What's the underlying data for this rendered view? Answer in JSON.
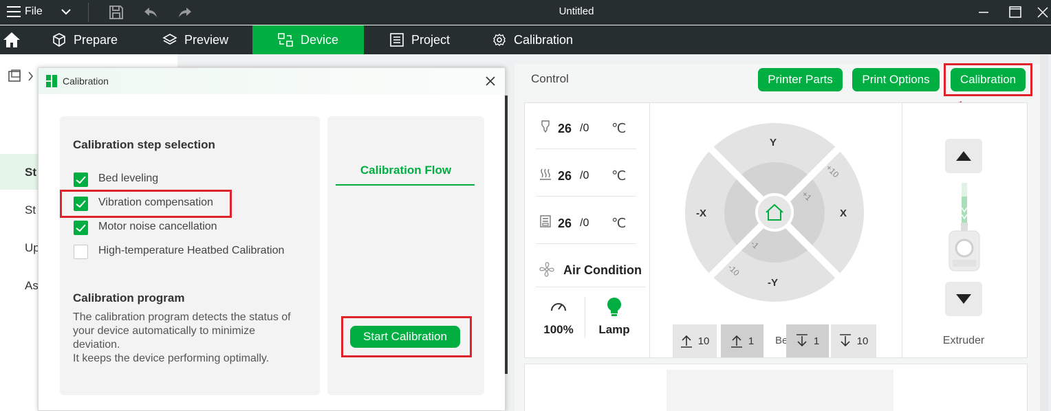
{
  "titlebar": {
    "file_label": "File",
    "doc_title": "Untitled"
  },
  "nav": {
    "tabs": [
      {
        "label": "Prepare",
        "icon": "cube-icon"
      },
      {
        "label": "Preview",
        "icon": "layers-icon"
      },
      {
        "label": "Device",
        "icon": "device-icon",
        "active": true
      },
      {
        "label": "Project",
        "icon": "project-icon"
      },
      {
        "label": "Calibration",
        "icon": "gear-icon"
      }
    ]
  },
  "sidebar": {
    "items": [
      "St",
      "St",
      "Up",
      "As"
    ]
  },
  "dialog": {
    "title": "Calibration",
    "step_title": "Calibration step selection",
    "steps": [
      {
        "label": "Bed leveling",
        "checked": true
      },
      {
        "label": "Vibration compensation",
        "checked": true
      },
      {
        "label": "Motor noise cancellation",
        "checked": true
      },
      {
        "label": "High-temperature Heatbed Calibration",
        "checked": false
      }
    ],
    "program_title": "Calibration program",
    "program_desc_1": "The calibration program detects the status of your device automatically to minimize deviation.",
    "program_desc_2": "It keeps the device performing optimally.",
    "flow_title": "Calibration Flow",
    "start_label": "Start Calibration"
  },
  "control": {
    "label": "Control",
    "buttons": {
      "printer_parts": "Printer Parts",
      "print_options": "Print Options",
      "calibration": "Calibration"
    },
    "temps": [
      {
        "icon": "nozzle-icon",
        "current": "26",
        "target": "/0",
        "unit": "℃"
      },
      {
        "icon": "heatbed-icon",
        "current": "26",
        "target": "/0",
        "unit": "℃"
      },
      {
        "icon": "chamber-icon",
        "current": "26",
        "target": "/0",
        "unit": "℃"
      }
    ],
    "air_condition": "Air Condition",
    "fan_speed": "100%",
    "lamp": "Lamp",
    "jog": {
      "y_plus": "Y",
      "y_minus": "-Y",
      "x_plus": "X",
      "x_minus": "-X",
      "step_10_pos": "+10",
      "step_1_pos": "+1",
      "step_1_neg": "-1",
      "step_10_neg": "-10"
    },
    "bed": {
      "label": "Bed",
      "up10": "10",
      "up1": "1",
      "down1": "1",
      "down10": "10"
    },
    "extruder_label": "Extruder"
  },
  "colors": {
    "accent": "#00ae42",
    "highlight": "#e0222b",
    "titlebar": "#262e30"
  }
}
